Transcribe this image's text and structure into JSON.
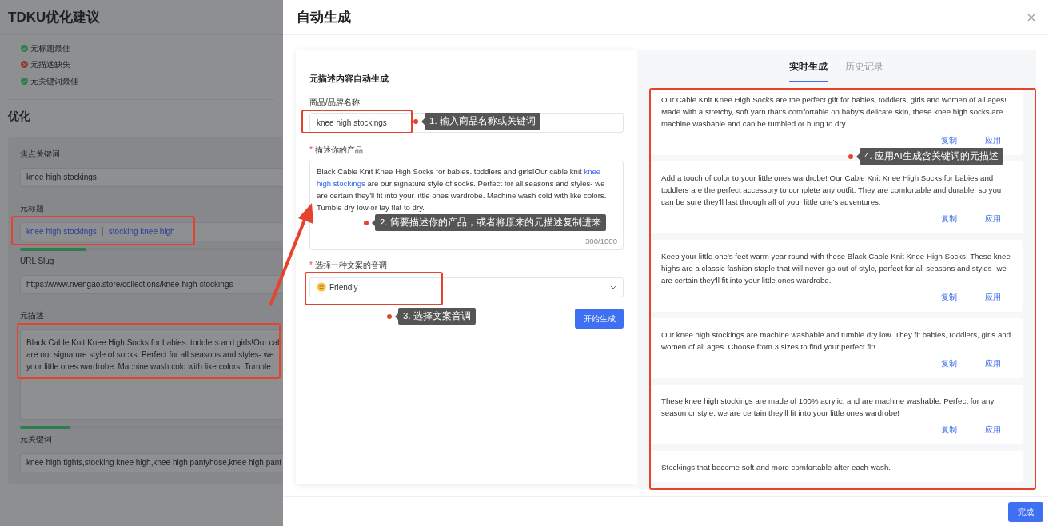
{
  "background_page": {
    "title": "TDKU优化建议",
    "checks": [
      {
        "label": "元标题最佳",
        "passed": true
      },
      {
        "label": "元描述缺失",
        "passed": false
      },
      {
        "label": "元关键词最佳",
        "passed": true
      }
    ],
    "section_title": "优化",
    "fields": [
      {
        "kind": "input",
        "label": "焦点关键词",
        "value": "knee high stockings"
      },
      {
        "kind": "tags",
        "label": "元标题",
        "tags": [
          "knee high stockings",
          "stocking knee high"
        ],
        "level": 0.25
      },
      {
        "kind": "input",
        "label": "URL Slug",
        "value": "https://www.rivengao.store/collections/knee-high-stockings"
      },
      {
        "kind": "textarea",
        "label": "元描述",
        "lines": [
          "Black Cable Knit Knee High Socks for babies. toddlers and girls!Our cab",
          "are our signature style of socks.  Perfect for all seasons and styles- we",
          "your little ones wardrobe. Machine wash cold with like colors.  Tumble"
        ],
        "level": 0.19
      },
      {
        "kind": "input",
        "label": "元关键词",
        "value": "knee high tights,stocking knee high,knee high pantyhose,knee high pant"
      }
    ]
  },
  "drawer": {
    "title": "自动生成",
    "form": {
      "title": "元描述内容自动生成",
      "product": {
        "label": "商品/品牌名称",
        "value": "knee high stockings"
      },
      "description": {
        "label": "描述你的产品",
        "required_mark": "*",
        "segments": [
          {
            "text": "Black Cable Knit Knee High Socks for babies. toddlers and girls!Our cable knit ",
            "keyword": false
          },
          {
            "text": "knee high stockings",
            "keyword": true
          },
          {
            "text": " are our signature style of socks.  Perfect for all seasons and styles- we are certain they'll fit into your little ones wardrobe. Machine wash cold with like colors.  Tumble dry low or lay flat to dry.",
            "keyword": false
          }
        ],
        "counter": "300/1000"
      },
      "tone": {
        "label": "选择一种文案的音调",
        "required_mark": "*",
        "value": "Friendly"
      },
      "generate_button": "开始生成"
    },
    "tabs": [
      {
        "label": "实时生成",
        "selected": true
      },
      {
        "label": "历史记录",
        "selected": false
      }
    ],
    "results": [
      {
        "text": "Our Cable Knit Knee High Socks are the perfect gift for babies, toddlers, girls and women of all ages! Made with a stretchy, soft yarn that's comfortable on baby's delicate skin, these knee high socks are machine washable and can be tumbled or hung to dry.",
        "actions": [
          "复制",
          "应用"
        ]
      },
      {
        "text": "Add a touch of color to your little ones wardrobe! Our Cable Knit Knee High Socks for babies and toddlers are the perfect accessory to complete any outfit. They are comfortable and durable, so you can be sure they'll last through all of your little one's adventures.",
        "actions": [
          "复制",
          "应用"
        ]
      },
      {
        "text": "Keep your little one's feet warm year round with these Black Cable Knit Knee High Socks. These knee highs are a classic fashion staple that will never go out of style, perfect for all seasons and styles- we are certain they'll fit into your little ones wardrobe.",
        "actions": [
          "复制",
          "应用"
        ]
      },
      {
        "text": "Our knee high stockings are machine washable and tumble dry low. They fit babies, toddlers, girls and women of all ages. Choose from 3 sizes to find your perfect fit!",
        "actions": [
          "复制",
          "应用"
        ]
      },
      {
        "text": "These knee high stockings are made of 100% acrylic, and are machine washable.  Perfect for any season or style, we are certain they'll fit into your little ones wardrobe!",
        "actions": [
          "复制",
          "应用"
        ]
      },
      {
        "text": "Stockings that become soft and more comfortable after each wash."
      }
    ],
    "done_button": "完成"
  },
  "annotations": {
    "callouts": [
      "1. 输入商品名称或关键词",
      "2. 简要描述你的产品，或者将原来的元描述复制进来",
      "3. 选择文案音调",
      "4. 应用AI生成含关键词的元描述"
    ]
  }
}
